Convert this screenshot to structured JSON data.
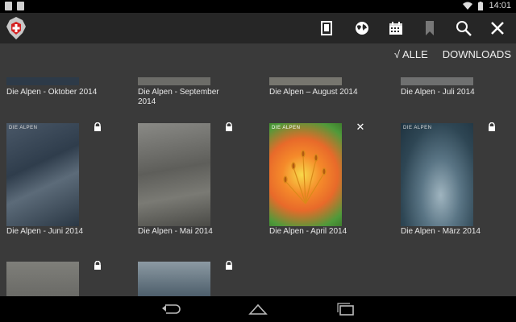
{
  "status_bar": {
    "time": "14:01"
  },
  "action_bar": {
    "icons": [
      "sac-logo-icon",
      "book-icon",
      "globe-icon",
      "calendar-icon",
      "bookmark-icon",
      "search-icon",
      "close-icon"
    ]
  },
  "filter": {
    "all_label": "√ ALLE",
    "downloads_label": "DOWNLOADS"
  },
  "issues": [
    {
      "title": "Die Alpen - Oktober 2014",
      "status": "none"
    },
    {
      "title": "Die Alpen - September 2014",
      "status": "none"
    },
    {
      "title": "Die Alpen – August 2014",
      "status": "none"
    },
    {
      "title": "Die Alpen - Juli 2014",
      "status": "none"
    },
    {
      "title": "Die Alpen - Juni 2014",
      "status": "locked",
      "cover_header": "DIE ALPEN"
    },
    {
      "title": "Die Alpen - Mai 2014",
      "status": "locked"
    },
    {
      "title": "Die Alpen - April 2014",
      "status": "downloaded",
      "cover_header": "DIE ALPEN"
    },
    {
      "title": "Die Alpen - März 2014",
      "status": "locked",
      "cover_header": "DIE ALPEN"
    },
    {
      "title": "",
      "status": "locked"
    },
    {
      "title": "",
      "status": "locked"
    }
  ],
  "nav_bar": {
    "icons": [
      "back-icon",
      "home-icon",
      "recents-icon"
    ]
  }
}
